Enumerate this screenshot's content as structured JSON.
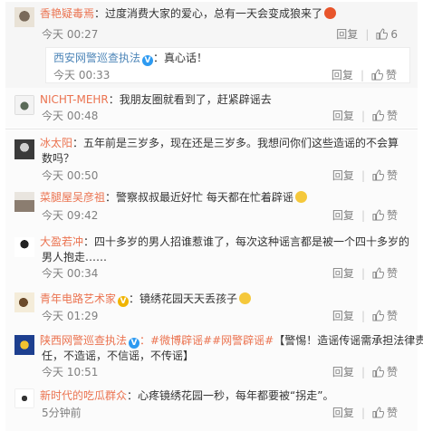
{
  "comments": [
    {
      "username": "香艳疑毒焉",
      "text": "：过度消费大家的爱心，总有一天会变成狼来了",
      "time": "今天 00:27",
      "reply": "回复",
      "like": "6",
      "nested": {
        "username": "西安网警巡查执法",
        "text": "：真心话！",
        "time": "今天 00:33",
        "reply": "回复",
        "like": "赞"
      }
    },
    {
      "username": "NICHT-MEHR",
      "text": "：我朋友圈就看到了，赶紧辟谣去",
      "time": "今天 00:48",
      "reply": "回复",
      "like": "赞"
    },
    {
      "username": "冰太阳",
      "text1": "：五年前是三岁多，现在还是三岁多。我想问你们这些造谣的不会算",
      "text2": "数吗？",
      "time": "今天 00:50",
      "reply": "回复",
      "like": "赞"
    },
    {
      "username": "菜腿屋吴彦祖",
      "text": "：警察叔叔最近好忙 每天都在忙着辟谣",
      "time": "今天 09:42",
      "reply": "回复",
      "like": "赞"
    },
    {
      "username": "大盈若冲",
      "text1": "：四十多岁的男人招谁惹谁了，每次这种谣言都是被一个四十多岁的",
      "text2": "男人抱走……",
      "time": "今天 00:34",
      "reply": "回复",
      "like": "赞"
    },
    {
      "username": "青年电路艺术家",
      "text": "：镜绣花园天天丢孩子",
      "time": "今天 01:29",
      "reply": "回复",
      "like": "赞"
    },
    {
      "username": "陕西网警巡查执法",
      "tags": "：#微博辟谣##网警辟谣#",
      "text1": "【警惕！造谣传谣需承担法律责",
      "text2": "任，不造谣，不信谣，不传谣】",
      "time": "今天 10:51",
      "reply": "回复",
      "like": "赞"
    },
    {
      "username": "新时代的吃瓜群众",
      "text": "：心疼镜绣花园一秒，每年都要被“拐走”。",
      "time": "5分钟前",
      "reply": "回复",
      "like": "赞"
    }
  ],
  "colors": {
    "username": "#eb7350",
    "timestamp": "#808080",
    "verified": "#2d9af1"
  },
  "icons": {
    "like": "thumb-up-icon",
    "verified": "verified-v-icon"
  }
}
